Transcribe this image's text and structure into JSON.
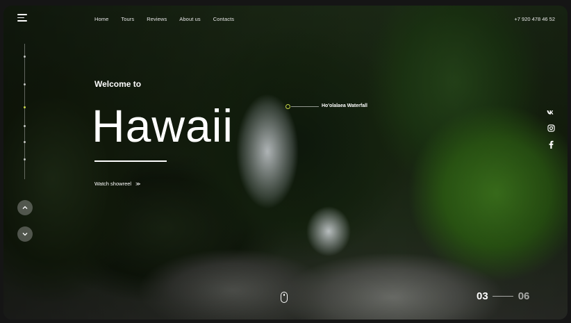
{
  "nav": {
    "items": [
      "Home",
      "Tours",
      "Reviews",
      "About us",
      "Contacts"
    ]
  },
  "phone": "+7 920 478 46 52",
  "hero": {
    "welcome": "Welcome to",
    "title": "Hawaii",
    "showreel": "Watch showreel",
    "showreel_arrow": "≫"
  },
  "marker": {
    "label": "Ho'olalaea Waterfall"
  },
  "social": [
    "vk-icon",
    "instagram-icon",
    "facebook-icon"
  ],
  "slider": {
    "current": "03",
    "total": "06"
  },
  "colors": {
    "accent": "#c9d84a",
    "text": "#ffffff"
  }
}
